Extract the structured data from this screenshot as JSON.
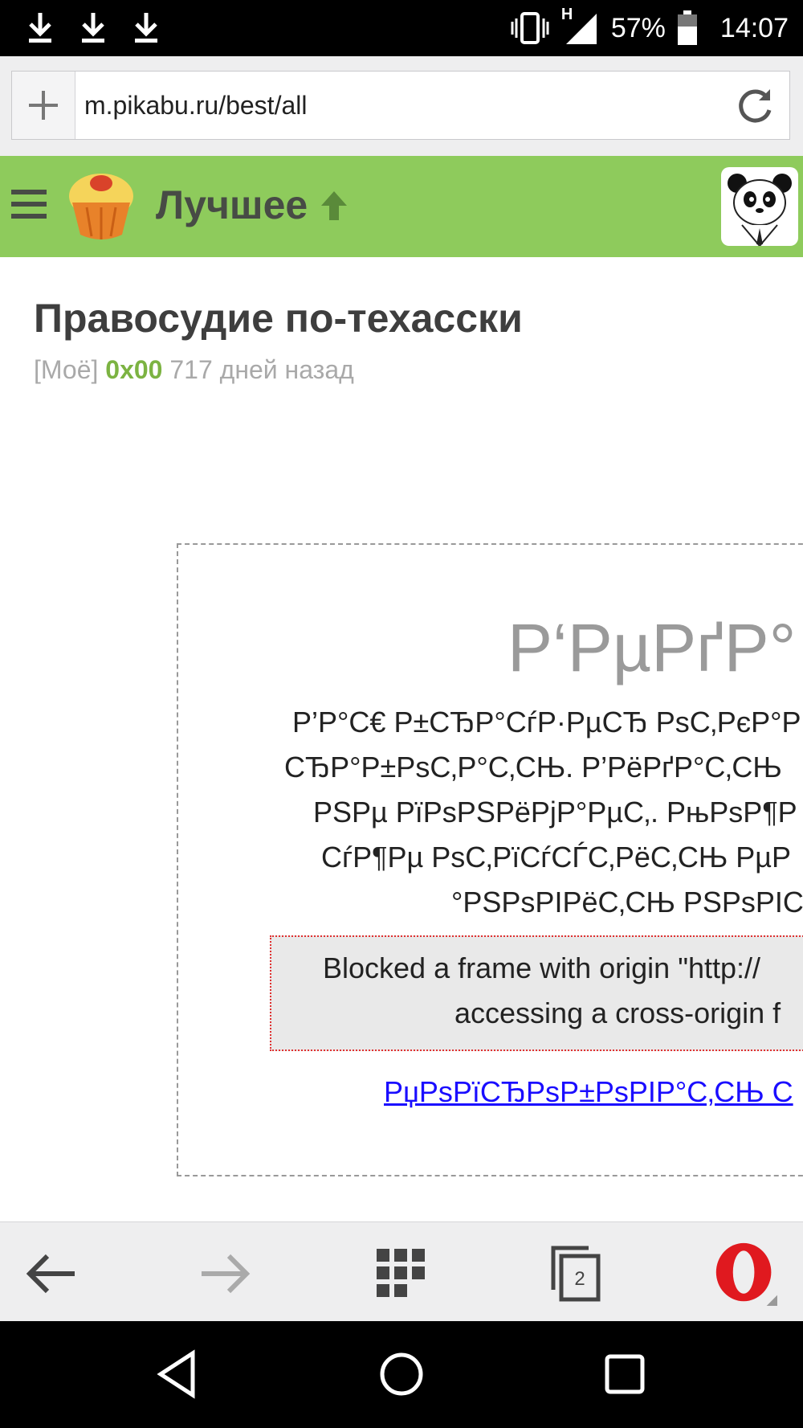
{
  "status_bar": {
    "network_label": "H",
    "battery": "57%",
    "time": "14:07",
    "icons": [
      "download-icon",
      "download-icon",
      "download-icon",
      "vibrate-icon",
      "signal-icon",
      "battery-icon"
    ]
  },
  "address_bar": {
    "url": "m.pikabu.ru/best/all",
    "icons": [
      "plus-icon",
      "reload-icon"
    ]
  },
  "site_header": {
    "title": "Лучшее",
    "icons": [
      "menu-icon",
      "cupcake-logo-icon",
      "arrow-up-icon",
      "panda-avatar-icon"
    ],
    "accent_color": "#8ecb5c"
  },
  "post": {
    "title": "Правосудие по-техасски",
    "tag": "[Моё]",
    "author": "0x00",
    "time_ago": "717 дней назад"
  },
  "embed": {
    "heading": "Р‘РµРґР° ;",
    "lines": [
      "Р’Р°С€ Р±СЂР°СѓР·РµСЂ РѕС‚РєР°Р",
      "СЂР°Р±РѕС‚Р°С‚СЊ. Р’РёРґР°С‚СЊ",
      "РЅРµ РїРѕРЅРёРјР°РµС‚. РњРѕР¶Р",
      "СѓР¶Рµ РѕС‚РїСѓСЃС‚РёС‚СЊ РµР",
      "°РЅРѕРІРёС‚СЊ РЅРѕРІС"
    ],
    "error_lines": [
      "Blocked a frame with origin \"http://",
      "accessing a cross-origin f"
    ],
    "link_text": "РџРѕРїСЂРѕР±РѕРІР°С‚СЊ С"
  },
  "bottom_toolbar": {
    "tab_count": "2",
    "icons": [
      "back-arrow-icon",
      "forward-arrow-icon",
      "speed-dial-icon",
      "tabs-icon",
      "opera-menu-icon"
    ]
  },
  "system_nav": {
    "icons": [
      "nav-back-icon",
      "nav-home-icon",
      "nav-recents-icon"
    ]
  }
}
